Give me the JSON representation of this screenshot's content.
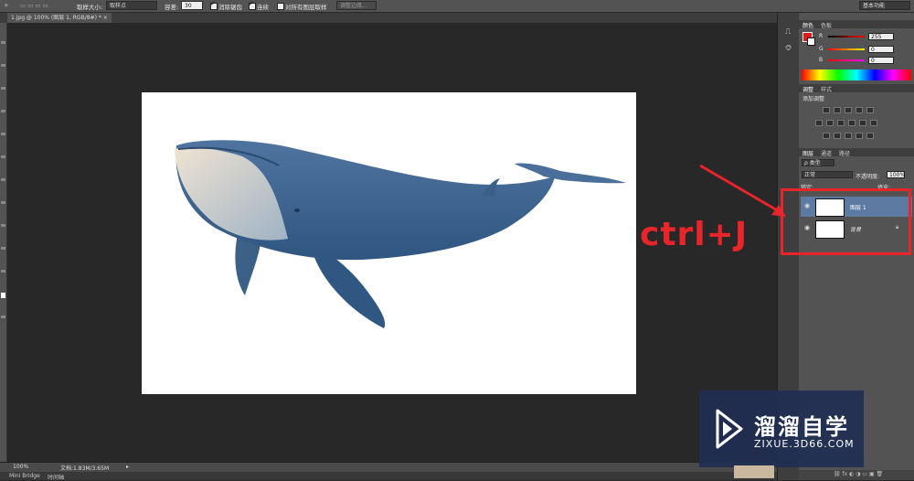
{
  "options_bar": {
    "sample_size_label": "取样大小:",
    "sample_size_value": "取样点",
    "tolerance_label": "容差:",
    "tolerance_value": "30",
    "anti_alias_label": "消除锯齿",
    "contiguous_label": "连续",
    "sample_all_layers_label": "对所有图层取样",
    "refine_edge_label": "调整边缘...",
    "workspace": "基本功能"
  },
  "document_tab": {
    "label": "1.jpg @ 100% (图层 1, RGB/8#) *"
  },
  "status_bar": {
    "zoom": "100%",
    "doc_info": "文档:1.83M/3.65M"
  },
  "bottom_tabs": [
    "Mini Bridge",
    "时间轴"
  ],
  "color_panel": {
    "tabs": [
      "颜色",
      "色板"
    ],
    "channels": [
      {
        "label": "R",
        "value": "255"
      },
      {
        "label": "G",
        "value": "0"
      },
      {
        "label": "B",
        "value": "0"
      }
    ],
    "foreground_color": "#e01a1a"
  },
  "adjustments_panel": {
    "tabs": [
      "调整",
      "样式"
    ],
    "title": "添加调整"
  },
  "layers_panel": {
    "tabs": [
      "图层",
      "通道",
      "路径"
    ],
    "filter_label": "ρ 类型",
    "blend_mode": "正常",
    "opacity_label": "不透明度:",
    "opacity_value": "100%",
    "lock_label": "锁定:",
    "fill_label": "填充:",
    "layers": [
      {
        "name": "图层 1",
        "selected": true
      },
      {
        "name": "背景",
        "selected": false,
        "locked": true
      }
    ]
  },
  "annotation": {
    "text": "ctrl+J",
    "color": "#e8252a"
  },
  "watermark": {
    "name": "溜溜自学",
    "url": "ZIXUE.3D66.COM"
  }
}
